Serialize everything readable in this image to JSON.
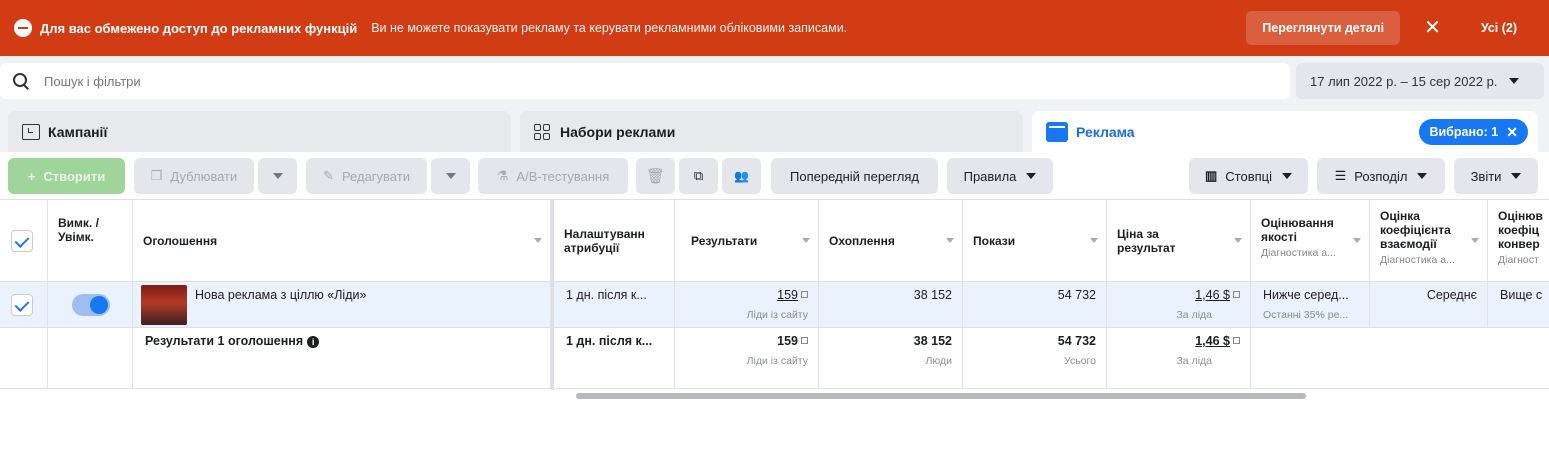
{
  "banner": {
    "title": "Для вас обмежено доступ до рекламних функцій",
    "message": "Ви не можете показувати рекламу та керувати рекламними обліковими записами.",
    "details_button": "Переглянути деталі",
    "close_glyph": "✕",
    "all_link": "Усі (2)"
  },
  "search": {
    "placeholder": "Пошук і фільтри"
  },
  "date_range": "17 лип 2022 р. – 15 сер 2022 р.",
  "tabs": [
    {
      "label": "Кампанії",
      "icon": "folder-icon"
    },
    {
      "label": "Набори реклами",
      "icon": "grid-icon"
    },
    {
      "label": "Реклама",
      "icon": "ad-icon",
      "badge": "Вибрано: 1",
      "badge_close": "✕"
    }
  ],
  "toolbar": {
    "create": "Створити",
    "duplicate": "Дублювати",
    "edit": "Редагувати",
    "ab_test": "A/B-тестування",
    "preview": "Попередній перегляд",
    "rules": "Правила",
    "columns": "Стовпці",
    "breakdown": "Розподіл",
    "reports": "Звіти"
  },
  "columns": {
    "toggle": "Вимк. / Увімк.",
    "ad": "Оголошення",
    "attribution": "Налаштуванн атрибуції",
    "results": "Результати",
    "reach": "Охоплення",
    "impressions": "Покази",
    "cost_per_result": "Ціна за результат",
    "quality": "Оцінювання якості",
    "quality_sub": "Діагностика а...",
    "engagement": "Оцінка коефіцієнта взаємодії",
    "engagement_sub": "Діагностика а...",
    "conversion": "Оцінюв коефіц конвер",
    "conversion_sub": "Діагност"
  },
  "rows": [
    {
      "name": "Нова реклама з ціллю «Ліди»",
      "attribution": "1 дн. після к...",
      "results": "159",
      "results_sub": "Ліди із сайту",
      "reach": "38 152",
      "impressions": "54 732",
      "cost": "1,46 $",
      "cost_sub": "За ліда",
      "quality": "Нижче серед...",
      "quality_sub": "Останні 35% ре...",
      "engagement": "Середнє",
      "conversion": "Вище с"
    }
  ],
  "summary": {
    "label": "Результати 1 оголошення",
    "attribution": "1 дн. після к...",
    "results": "159",
    "results_sub": "Ліди із сайту",
    "reach": "38 152",
    "reach_sub": "Люди",
    "impressions": "54 732",
    "impressions_sub": "Усього",
    "cost": "1,46 $",
    "cost_sub": "За ліда"
  }
}
